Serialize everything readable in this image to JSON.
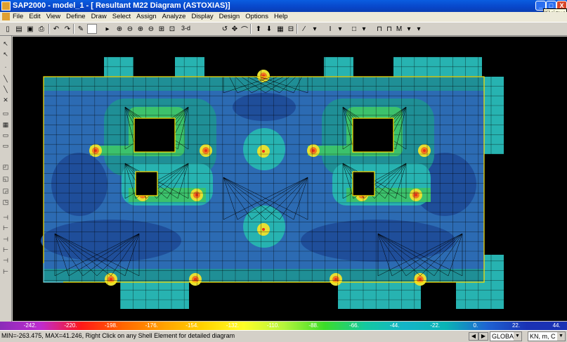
{
  "window": {
    "title": "SAP2000 - model_1 - [  Resultant M22 Diagram  (ASTOXIAS)]",
    "controls": [
      "_",
      "□",
      "X"
    ],
    "tooltip": "Κλείσιμο"
  },
  "menu": {
    "items": [
      "File",
      "Edit",
      "View",
      "Define",
      "Draw",
      "Select",
      "Assign",
      "Analyze",
      "Display",
      "Design",
      "Options",
      "Help"
    ]
  },
  "toolbar": {
    "view_3d_label": "3-d"
  },
  "legend": {
    "labels": [
      "-242.",
      "-220.",
      "-198.",
      "-176.",
      "-154.",
      "-132.",
      "-110.",
      "-88.",
      "-66.",
      "-44.",
      "-22.",
      "0.",
      "22.",
      "44."
    ],
    "colors": [
      "#8a2cb8",
      "#c02bd0",
      "#ff1818",
      "#ff6400",
      "#ffa000",
      "#ffd200",
      "#ffff28",
      "#b4f53c",
      "#3cdc28",
      "#14c8a0",
      "#14b4c8",
      "#0ab4b4",
      "#1e64d2",
      "#1a32b4"
    ]
  },
  "status": {
    "message": "MIN=-263.475, MAX=41.246, Right Click on any Shell Element for detailed diagram",
    "coord_system": "GLOBAL",
    "units": "KN, m, C"
  },
  "contour_colors": {
    "dark_blue": "#1f4e9a",
    "blue": "#2c6bb3",
    "teal": "#1f8f96",
    "cyan": "#27b3b1",
    "green": "#3cc26c",
    "yellow": "#e6e032",
    "orange": "#f07a20",
    "red": "#e8301c"
  }
}
